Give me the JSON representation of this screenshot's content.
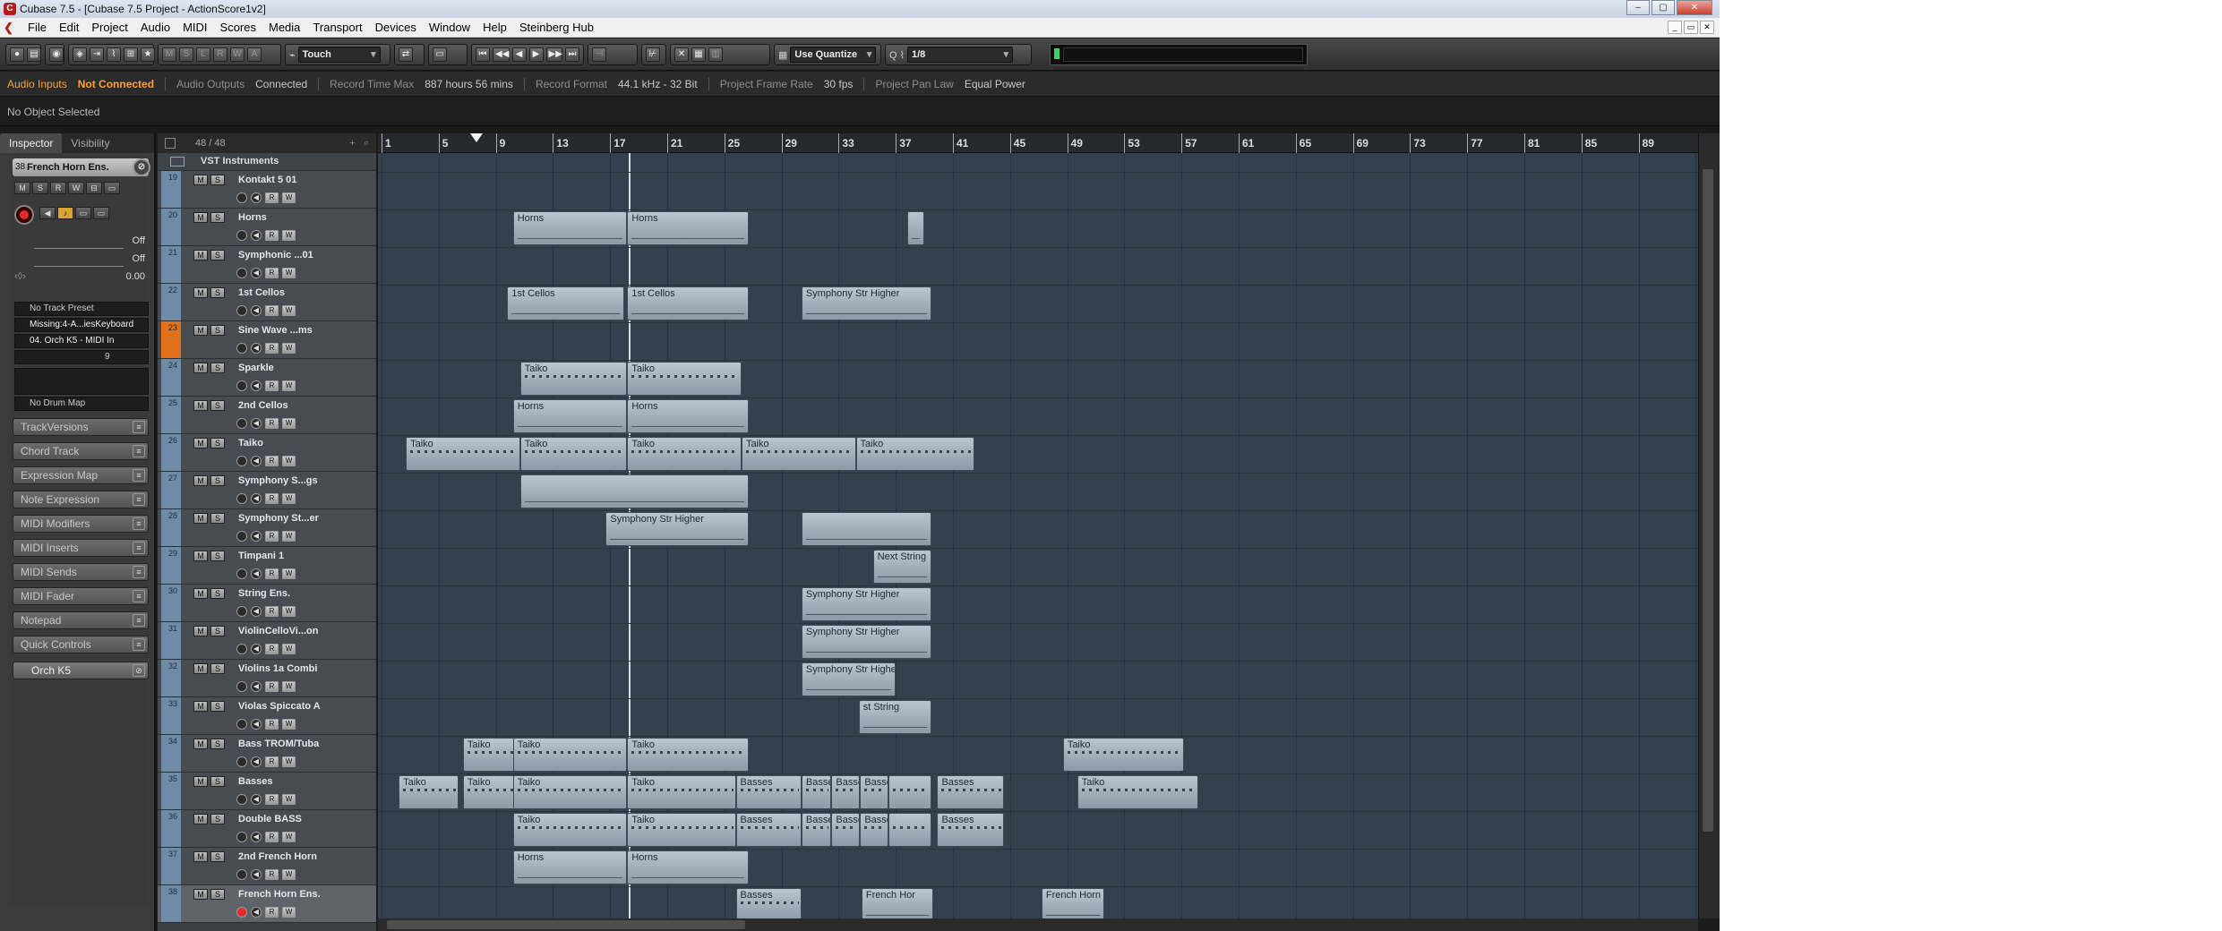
{
  "window": {
    "title": "Cubase 7.5 - [Cubase 7.5 Project - ActionScore1v2]"
  },
  "menu": [
    "File",
    "Edit",
    "Project",
    "Audio",
    "MIDI",
    "Scores",
    "Media",
    "Transport",
    "Devices",
    "Window",
    "Help",
    "Steinberg Hub"
  ],
  "toolbar": {
    "msr": [
      "M",
      "S",
      "L",
      "R",
      "W",
      "A"
    ],
    "automation_mode": "Touch",
    "quantize_mode": "Use Quantize",
    "quantize_value": "1/8"
  },
  "status": {
    "audio_inputs_label": "Audio Inputs",
    "audio_inputs_value": "Not Connected",
    "audio_outputs_label": "Audio Outputs",
    "audio_outputs_value": "Connected",
    "record_time_label": "Record Time Max",
    "record_time_value": "887 hours 56 mins",
    "record_format_label": "Record Format",
    "record_format_value": "44.1 kHz - 32 Bit",
    "frame_rate_label": "Project Frame Rate",
    "frame_rate_value": "30 fps",
    "pan_law_label": "Project Pan Law",
    "pan_law_value": "Equal Power"
  },
  "info_line": "No Object Selected",
  "inspector": {
    "tabs": [
      "Inspector",
      "Visibility"
    ],
    "track_number": "38",
    "track_name": "French Horn Ens.",
    "vol_value": "Off",
    "pan_value": "Off",
    "delay_value": "0.00",
    "track_preset": "No Track Preset",
    "midi_input": "Missing:4-A...iesKeyboard",
    "midi_output": "04. Orch K5 - MIDI In",
    "channel": "9",
    "drum_map": "No Drum Map",
    "sections": [
      "TrackVersions",
      "Chord Track",
      "Expression Map",
      "Note Expression",
      "MIDI Modifiers",
      "MIDI Inserts",
      "MIDI Sends",
      "MIDI Fader",
      "Notepad",
      "Quick Controls"
    ],
    "instrument": "Orch K5"
  },
  "tracklist": {
    "count": "48 / 48",
    "folder": "VST Instruments",
    "tracks": [
      {
        "num": "19",
        "name": "Kontakt 5 01"
      },
      {
        "num": "20",
        "name": "Horns"
      },
      {
        "num": "21",
        "name": "Symphonic ...01"
      },
      {
        "num": "22",
        "name": "1st Cellos"
      },
      {
        "num": "23",
        "name": "Sine Wave ...ms"
      },
      {
        "num": "24",
        "name": "Sparkle"
      },
      {
        "num": "25",
        "name": "2nd Cellos"
      },
      {
        "num": "26",
        "name": "Taiko"
      },
      {
        "num": "27",
        "name": "Symphony S...gs"
      },
      {
        "num": "28",
        "name": "Symphony St...er"
      },
      {
        "num": "29",
        "name": "Timpani 1"
      },
      {
        "num": "30",
        "name": "String Ens."
      },
      {
        "num": "31",
        "name": "ViolinCelloVi...on"
      },
      {
        "num": "32",
        "name": "Violins 1a Combi"
      },
      {
        "num": "33",
        "name": "Violas Spiccato A"
      },
      {
        "num": "34",
        "name": "Bass TROM/Tuba"
      },
      {
        "num": "35",
        "name": "Basses"
      },
      {
        "num": "36",
        "name": "Double BASS"
      },
      {
        "num": "37",
        "name": "2nd French Horn"
      },
      {
        "num": "38",
        "name": "French Horn Ens."
      }
    ]
  },
  "ruler": [
    "1",
    "5",
    "9",
    "13",
    "17",
    "21",
    "25",
    "29",
    "33",
    "37",
    "41",
    "45",
    "49",
    "53",
    "57",
    "61",
    "65",
    "69",
    "73",
    "77",
    "81",
    "85",
    "89"
  ],
  "parts": [
    {
      "row": 1,
      "bar": 10.2,
      "len": 8,
      "name": "Horns",
      "k": "w"
    },
    {
      "row": 1,
      "bar": 18.2,
      "len": 8.5,
      "name": "Horns",
      "k": "w"
    },
    {
      "row": 1,
      "bar": 37.8,
      "len": 1.2,
      "name": "",
      "k": "w"
    },
    {
      "row": 3,
      "bar": 9.8,
      "len": 8.2,
      "name": "1st Cellos",
      "k": "w"
    },
    {
      "row": 3,
      "bar": 18.2,
      "len": 8.5,
      "name": "1st Cellos",
      "k": "w"
    },
    {
      "row": 3,
      "bar": 30.4,
      "len": 9.1,
      "name": "Symphony Str Higher",
      "k": "w"
    },
    {
      "row": 5,
      "bar": 10.7,
      "len": 7.5,
      "name": "Taiko",
      "k": "d"
    },
    {
      "row": 5,
      "bar": 18.2,
      "len": 8,
      "name": "Taiko",
      "k": "d"
    },
    {
      "row": 6,
      "bar": 10.2,
      "len": 8,
      "name": "Horns",
      "k": "w"
    },
    {
      "row": 6,
      "bar": 18.2,
      "len": 8.5,
      "name": "Horns",
      "k": "w"
    },
    {
      "row": 7,
      "bar": 2.7,
      "len": 8,
      "name": "Taiko",
      "k": "d"
    },
    {
      "row": 7,
      "bar": 10.7,
      "len": 7.5,
      "name": "Taiko",
      "k": "d"
    },
    {
      "row": 7,
      "bar": 18.2,
      "len": 8,
      "name": "Taiko",
      "k": "d"
    },
    {
      "row": 7,
      "bar": 26.2,
      "len": 8,
      "name": "Taiko",
      "k": "d"
    },
    {
      "row": 7,
      "bar": 34.2,
      "len": 8.3,
      "name": "Taiko",
      "k": "d"
    },
    {
      "row": 8,
      "bar": 10.7,
      "len": 16,
      "name": "",
      "k": "w"
    },
    {
      "row": 9,
      "bar": 16.7,
      "len": 10,
      "name": "Symphony Str Higher",
      "k": "w"
    },
    {
      "row": 9,
      "bar": 30.4,
      "len": 9.1,
      "name": "",
      "k": "w"
    },
    {
      "row": 10,
      "bar": 35.4,
      "len": 4.1,
      "name": "Next String",
      "k": "w"
    },
    {
      "row": 11,
      "bar": 30.4,
      "len": 9.1,
      "name": "Symphony Str Higher",
      "k": "w"
    },
    {
      "row": 12,
      "bar": 30.4,
      "len": 9.1,
      "name": "Symphony Str Higher",
      "k": "w"
    },
    {
      "row": 13,
      "bar": 30.4,
      "len": 6.6,
      "name": "Symphony Str Higher",
      "k": "w"
    },
    {
      "row": 14,
      "bar": 34.4,
      "len": 5.1,
      "name": "st String",
      "k": "w"
    },
    {
      "row": 15,
      "bar": 6.7,
      "len": 4,
      "name": "Taiko",
      "k": "d"
    },
    {
      "row": 15,
      "bar": 10.2,
      "len": 8,
      "name": "Taiko",
      "k": "d"
    },
    {
      "row": 15,
      "bar": 18.2,
      "len": 8.5,
      "name": "Taiko",
      "k": "d"
    },
    {
      "row": 15,
      "bar": 48.7,
      "len": 8.5,
      "name": "Taiko",
      "k": "d"
    },
    {
      "row": 16,
      "bar": 2.2,
      "len": 4.2,
      "name": "Taiko",
      "k": "d"
    },
    {
      "row": 16,
      "bar": 6.7,
      "len": 3.8,
      "name": "Taiko",
      "k": "d"
    },
    {
      "row": 16,
      "bar": 10.2,
      "len": 8,
      "name": "Taiko",
      "k": "d"
    },
    {
      "row": 16,
      "bar": 18.2,
      "len": 7.6,
      "name": "Taiko",
      "k": "d"
    },
    {
      "row": 16,
      "bar": 25.8,
      "len": 4.6,
      "name": "Basses",
      "k": "d"
    },
    {
      "row": 16,
      "bar": 30.4,
      "len": 2.1,
      "name": "Basse",
      "k": "d"
    },
    {
      "row": 16,
      "bar": 32.5,
      "len": 2,
      "name": "Basse",
      "k": "d"
    },
    {
      "row": 16,
      "bar": 34.5,
      "len": 2,
      "name": "Basse",
      "k": "d"
    },
    {
      "row": 16,
      "bar": 36.5,
      "len": 3,
      "name": "",
      "k": "d"
    },
    {
      "row": 16,
      "bar": 39.9,
      "len": 4.7,
      "name": "Basses",
      "k": "d"
    },
    {
      "row": 16,
      "bar": 49.7,
      "len": 8.5,
      "name": "Taiko",
      "k": "d"
    },
    {
      "row": 17,
      "bar": 10.2,
      "len": 8,
      "name": "Taiko",
      "k": "d"
    },
    {
      "row": 17,
      "bar": 18.2,
      "len": 7.6,
      "name": "Taiko",
      "k": "d"
    },
    {
      "row": 17,
      "bar": 25.8,
      "len": 4.6,
      "name": "Basses",
      "k": "d"
    },
    {
      "row": 17,
      "bar": 30.4,
      "len": 2.1,
      "name": "Basse",
      "k": "d"
    },
    {
      "row": 17,
      "bar": 32.5,
      "len": 2,
      "name": "Basse",
      "k": "d"
    },
    {
      "row": 17,
      "bar": 34.5,
      "len": 2,
      "name": "Basse",
      "k": "d"
    },
    {
      "row": 17,
      "bar": 36.5,
      "len": 3,
      "name": "",
      "k": "d"
    },
    {
      "row": 17,
      "bar": 39.9,
      "len": 4.7,
      "name": "Basses",
      "k": "d"
    },
    {
      "row": 18,
      "bar": 10.2,
      "len": 8,
      "name": "Horns",
      "k": "w"
    },
    {
      "row": 18,
      "bar": 18.2,
      "len": 8.5,
      "name": "Horns",
      "k": "w"
    },
    {
      "row": 19,
      "bar": 25.8,
      "len": 4.6,
      "name": "Basses",
      "k": "d"
    },
    {
      "row": 19,
      "bar": 34.6,
      "len": 5,
      "name": "French Hor",
      "k": "w"
    },
    {
      "row": 19,
      "bar": 47.2,
      "len": 4.4,
      "name": "French Horn",
      "k": "w"
    }
  ]
}
